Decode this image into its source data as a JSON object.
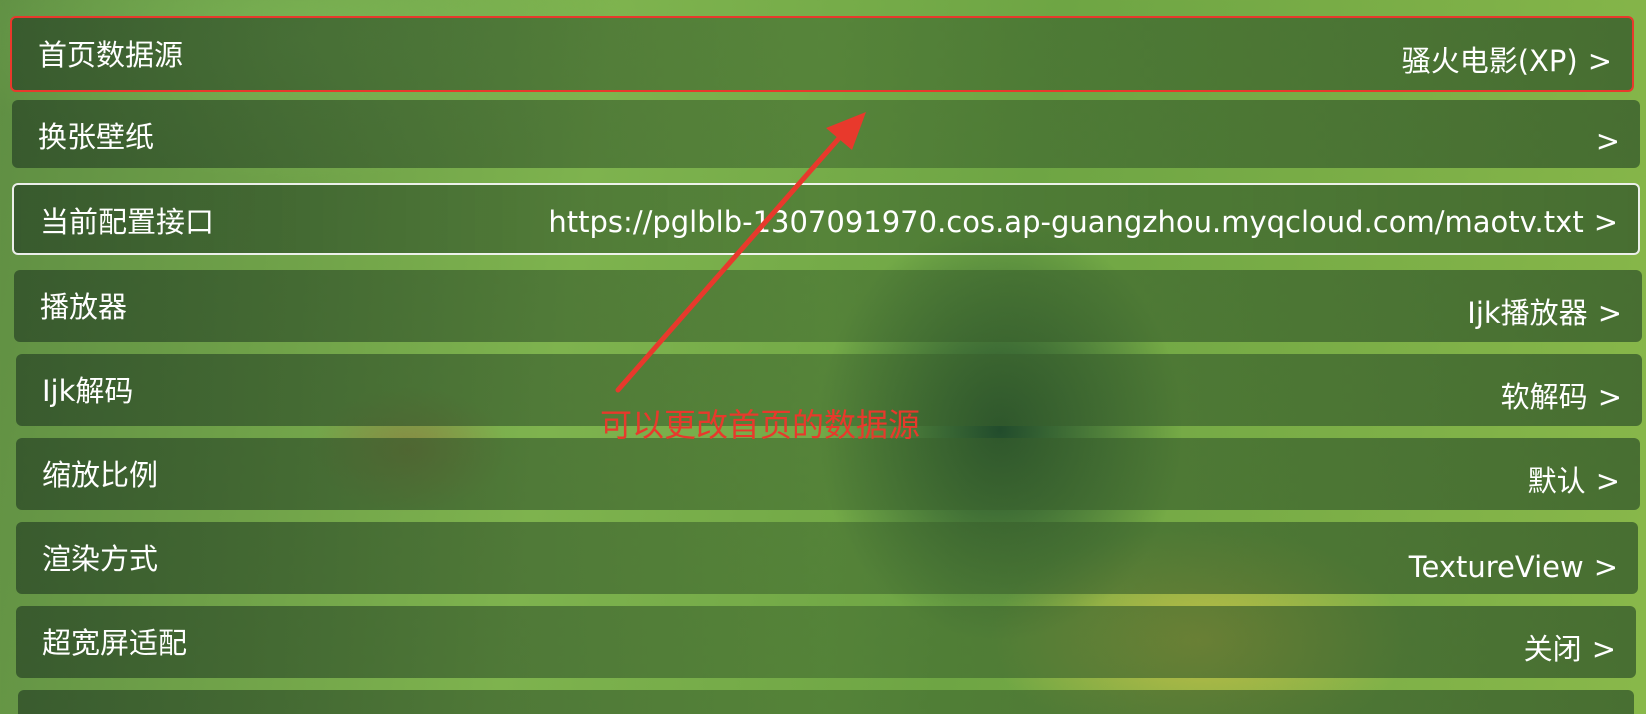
{
  "settings": {
    "items": [
      {
        "label": "首页数据源",
        "value": "骚火电影(XP)",
        "chevron": ">"
      },
      {
        "label": "换张壁纸",
        "value": "",
        "chevron": ">"
      },
      {
        "label": "当前配置接口",
        "value": "https://pglblb-1307091970.cos.ap-guangzhou.myqcloud.com/maotv.txt",
        "chevron": ">"
      },
      {
        "label": "播放器",
        "value": "Ijk播放器",
        "chevron": ">"
      },
      {
        "label": "Ijk解码",
        "value": "软解码",
        "chevron": ">"
      },
      {
        "label": "缩放比例",
        "value": "默认",
        "chevron": ">"
      },
      {
        "label": "渲染方式",
        "value": "TextureView",
        "chevron": ">"
      },
      {
        "label": "超宽屏适配",
        "value": "关闭",
        "chevron": ">"
      }
    ]
  },
  "annotation": {
    "text": "可以更改首页的数据源",
    "color": "#e8392c"
  }
}
